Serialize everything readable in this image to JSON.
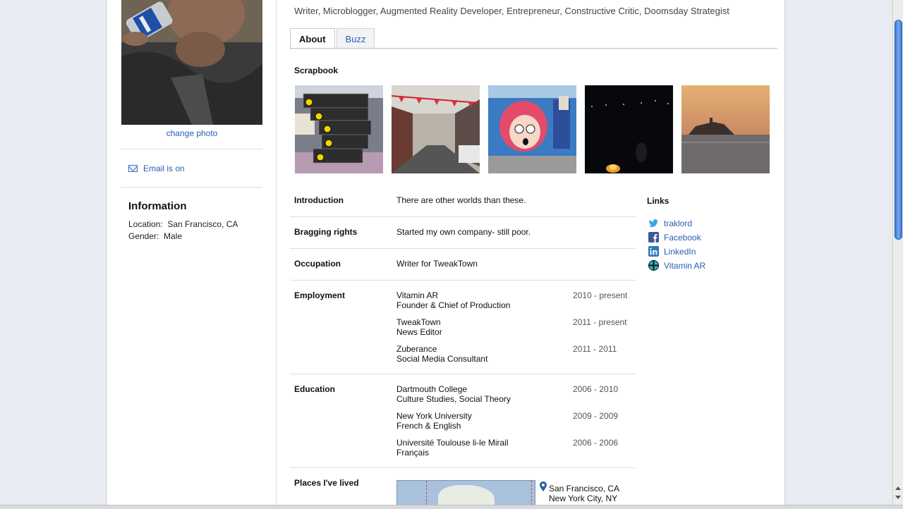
{
  "left": {
    "change_photo": "change photo",
    "email_status": "Email is on",
    "information": {
      "title": "Information",
      "location_label": "Location:",
      "location_value": "San Francisco, CA",
      "gender_label": "Gender:",
      "gender_value": "Male"
    }
  },
  "profile": {
    "tagline": "Writer, Microblogger, Augmented Reality Developer, Entrepreneur, Constructive Critic, Doomsday Strategist"
  },
  "tabs": [
    {
      "label": "About",
      "active": true
    },
    {
      "label": "Buzz",
      "active": false
    }
  ],
  "scrapbook": {
    "title": "Scrapbook",
    "photos": [
      "ar-app-screenshot",
      "chinatown-street",
      "graffiti-mural",
      "night-campfire",
      "alcatraz-sunset"
    ]
  },
  "about": {
    "introduction": {
      "label": "Introduction",
      "value": "There are other worlds than these."
    },
    "bragging": {
      "label": "Bragging rights",
      "value": "Started my own company- still poor."
    },
    "occupation": {
      "label": "Occupation",
      "value": "Writer for TweakTown"
    },
    "employment": {
      "label": "Employment",
      "items": [
        {
          "org": "Vitamin AR",
          "role": "Founder & Chief of Production",
          "years": "2010 - present"
        },
        {
          "org": "TweakTown",
          "role": "News Editor",
          "years": "2011 - present"
        },
        {
          "org": "Zuberance",
          "role": "Social Media Consultant",
          "years": "2011 - 2011"
        }
      ]
    },
    "education": {
      "label": "Education",
      "items": [
        {
          "org": "Dartmouth College",
          "role": "Culture Studies, Social Theory",
          "years": "2006 - 2010"
        },
        {
          "org": "New York University",
          "role": "French & English",
          "years": "2009 - 2009"
        },
        {
          "org": "Université Toulouse li-le Mirail",
          "role": "Français",
          "years": "2006 - 2006"
        }
      ]
    },
    "places": {
      "label": "Places I've lived",
      "items": [
        "San Francisco, CA",
        "New York City, NY"
      ]
    }
  },
  "links": {
    "title": "Links",
    "items": [
      {
        "label": "traklord",
        "icon": "twitter-icon"
      },
      {
        "label": "Facebook",
        "icon": "facebook-icon"
      },
      {
        "label": "LinkedIn",
        "icon": "linkedin-icon"
      },
      {
        "label": "Vitamin AR",
        "icon": "vitamin-ar-icon"
      }
    ]
  },
  "colors": {
    "link": "#2a5db0",
    "background": "#e8ebf1",
    "scroll_thumb": "#3b78d8"
  }
}
